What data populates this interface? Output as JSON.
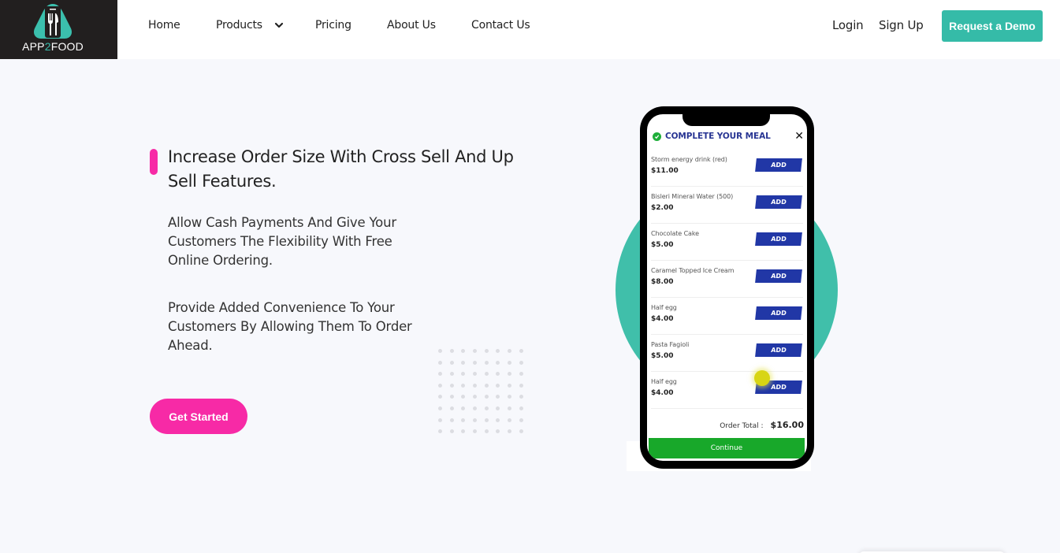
{
  "brand": {
    "name_prefix": "APP",
    "name_accent": "2",
    "name_suffix": "FOOD",
    "logo_icon": "phone-fork-knife-icon",
    "colors": {
      "logo_bg": "#221f1f",
      "teal": "#35bba8",
      "pink": "#f72aa6",
      "add_blue": "#2137a6",
      "continue_green": "#18a82a"
    }
  },
  "nav": {
    "items": [
      {
        "label": "Home"
      },
      {
        "label": "Products",
        "has_dropdown": true,
        "icon": "chevron-down-icon"
      },
      {
        "label": "Pricing"
      },
      {
        "label": "About Us"
      },
      {
        "label": "Contact Us"
      }
    ],
    "login": "Login",
    "signup": "Sign Up",
    "demo_button": "Request a Demo"
  },
  "hero": {
    "title": "Increase Order Size With Cross Sell And Up Sell Features.",
    "paragraph_1": "Allow Cash Payments And Give Your Customers The Flexibility With Free Online Ordering.",
    "paragraph_2": "Provide Added Convenience To Your Customers By Allowing Them To Order Ahead.",
    "cta": "Get Started"
  },
  "phone": {
    "header_title": "COMPLETE YOUR MEAL",
    "header_icon": "check-circle-icon",
    "close_icon": "close-icon",
    "items": [
      {
        "name": "Storm energy drink (red)",
        "price": "$11.00",
        "action": "ADD"
      },
      {
        "name": "Bisleri Mineral Water (500)",
        "price": "$2.00",
        "action": "ADD"
      },
      {
        "name": "Chocolate Cake",
        "price": "$5.00",
        "action": "ADD"
      },
      {
        "name": "Caramel Topped Ice Cream",
        "price": "$8.00",
        "action": "ADD"
      },
      {
        "name": "Half egg",
        "price": "$4.00",
        "action": "ADD"
      },
      {
        "name": "Pasta Fagioli",
        "price": "$5.00",
        "action": "ADD"
      },
      {
        "name": "Half egg",
        "price": "$4.00",
        "action": "ADD"
      }
    ],
    "order_total_label": "Order Total :",
    "order_total_value": "$16.00",
    "continue_label": "Continue"
  }
}
